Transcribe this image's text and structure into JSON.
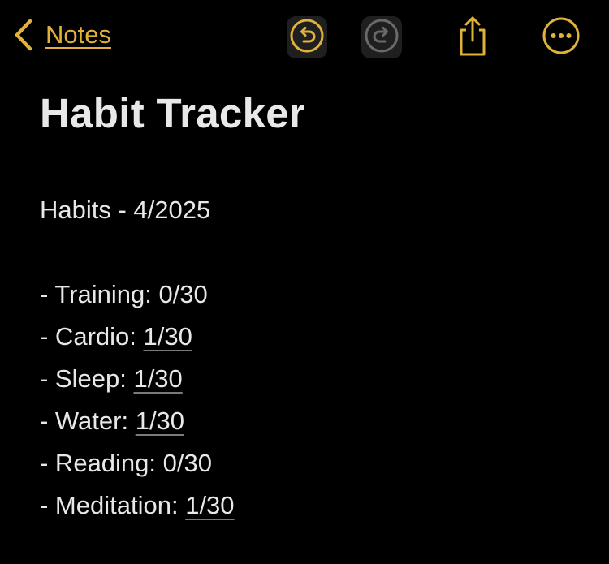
{
  "app": {
    "accent_color": "#e0b23a",
    "background_color": "#000000",
    "text_color": "#e8e8e8"
  },
  "toolbar": {
    "back_label": "Notes",
    "back_icon": "chevron-left-icon",
    "undo_icon": "undo-icon",
    "redo_icon": "redo-icon",
    "share_icon": "share-icon",
    "more_icon": "ellipsis-circle-icon"
  },
  "note": {
    "title": "Habit Tracker",
    "heading": "Habits - 4/2025",
    "habits": [
      {
        "prefix": "- Training: ",
        "value": "0/30",
        "linked": false
      },
      {
        "prefix": "- Cardio: ",
        "value": "1/30",
        "linked": true
      },
      {
        "prefix": "- Sleep: ",
        "value": "1/30",
        "linked": true
      },
      {
        "prefix": "- Water: ",
        "value": "1/30",
        "linked": true
      },
      {
        "prefix": "- Reading: ",
        "value": "0/30",
        "linked": false
      },
      {
        "prefix": "- Meditation: ",
        "value": "1/30",
        "linked": true
      }
    ]
  }
}
